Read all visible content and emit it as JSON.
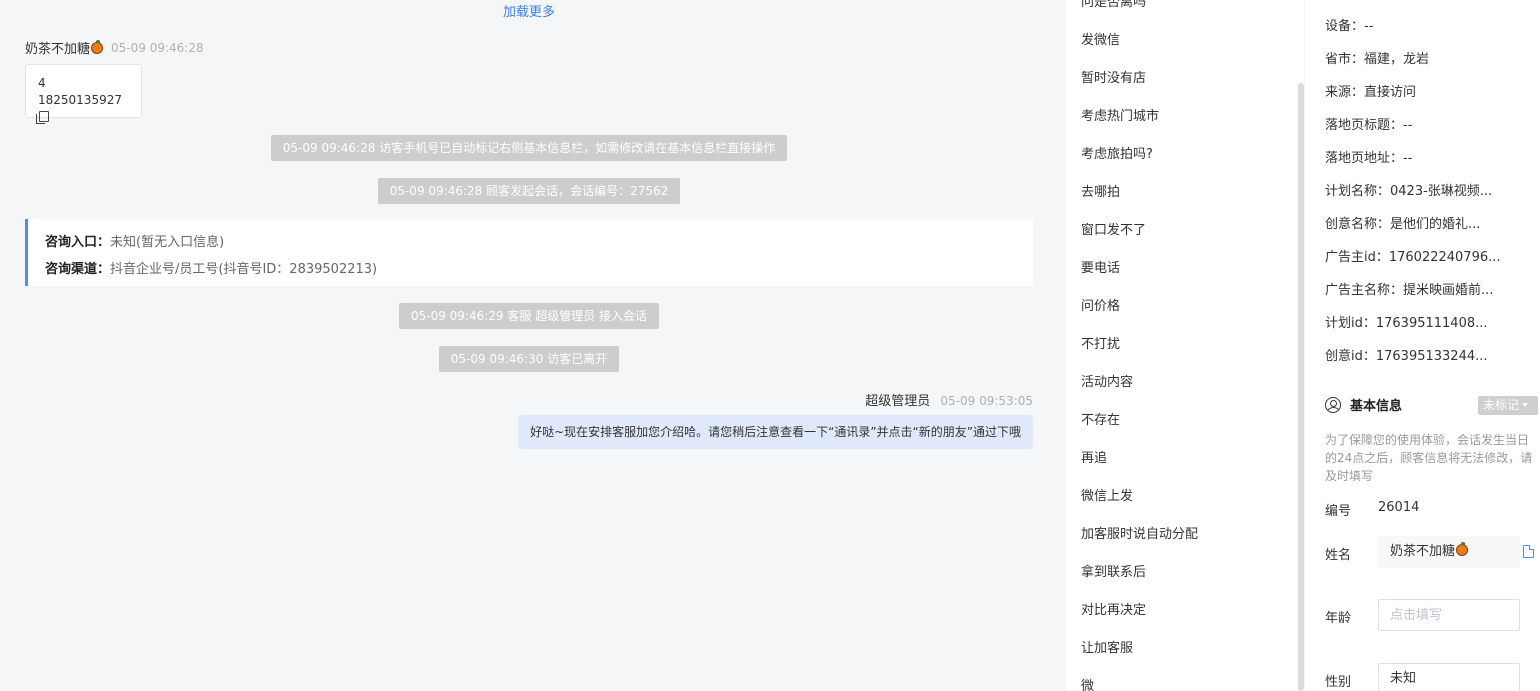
{
  "chat": {
    "load_more": "加载更多",
    "visitor_name": "奶茶不加糖",
    "visitor_time": "05-09 09:46:28",
    "visitor_msg_line1": "4",
    "visitor_msg_line2": "18250135927",
    "system_messages": [
      "05-09 09:46:28 访客手机号已自动标记右侧基本信息栏，如需修改请在基本信息栏直接操作",
      "05-09 09:46:28 顾客发起会话，会话编号：27562",
      "05-09 09:46:29 客服 超级管理员 接入会话",
      "05-09 09:46:30 访客已离开"
    ],
    "consult_entry_label": "咨询入口：",
    "consult_entry_value": "未知(暂无入口信息)",
    "consult_channel_label": "咨询渠道：",
    "consult_channel_value": "抖音企业号/员工号(抖音号ID：2839502213)",
    "agent_name": "超级管理员",
    "agent_time": "05-09 09:53:05",
    "agent_msg": "好哒~现在安排客服加您介绍哈。请您稍后注意查看一下“通讯录”并点击“新的朋友”通过下哦"
  },
  "quick_replies": [
    "问是否离吗",
    "发微信",
    "暂时没有店",
    "考虑热门城市",
    "考虑旅拍吗?",
    "去哪拍",
    "窗口发不了",
    "要电话",
    "问价格",
    "不打扰",
    "活动内容",
    "不存在",
    "再追",
    "微信上发",
    "加客服时说自动分配",
    "拿到联系后",
    "对比再决定",
    "让加客服",
    "微"
  ],
  "info": {
    "rows": [
      "设备：--",
      "省市：福建，龙岩",
      "来源：直接访问",
      "落地页标题：--",
      "落地页地址：--",
      "计划名称：0423-张琳视频...",
      "创意名称：是他们的婚礼...",
      "广告主id：176022240796...",
      "广告主名称：提米映画婚前...",
      "计划id：176395111408...",
      "创意id：176395133244..."
    ],
    "basic_title": "基本信息",
    "tag_label": "未标记",
    "notice": "为了保障您的使用体验，会话发生当日的24点之后，顾客信息将无法修改，请及时填写",
    "number_label": "编号",
    "number_value": "26014",
    "name_label": "姓名",
    "name_value": "奶茶不加糖",
    "age_label": "年龄",
    "age_placeholder": "点击填写",
    "gender_label": "性别",
    "gender_value": "未知"
  }
}
